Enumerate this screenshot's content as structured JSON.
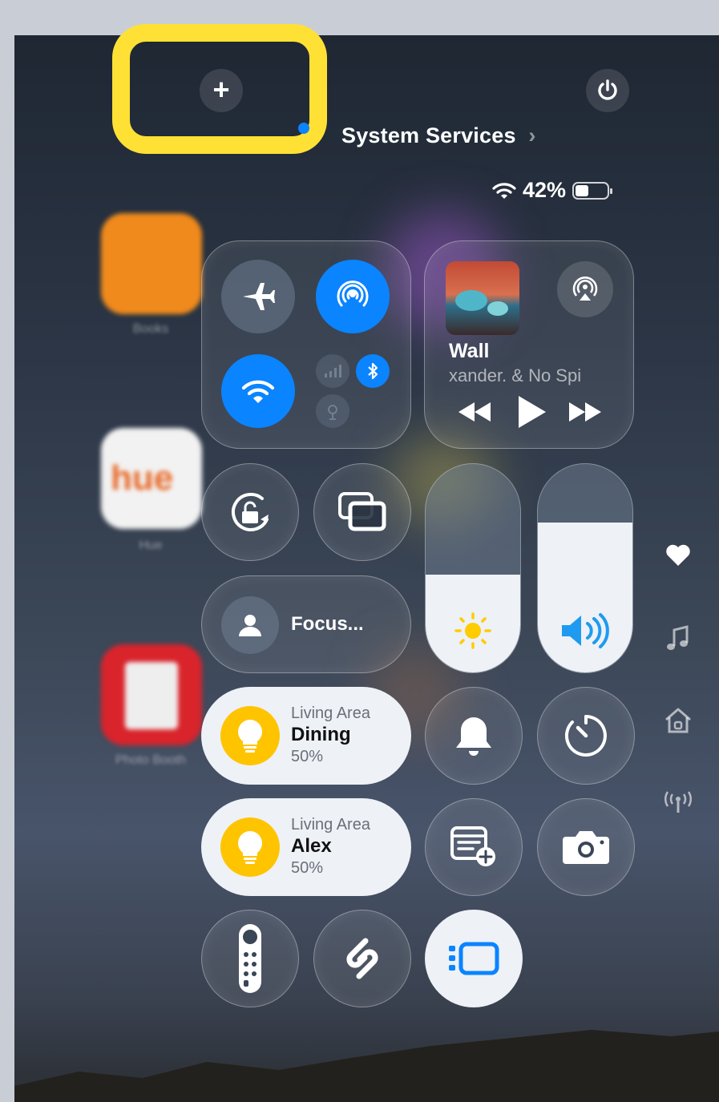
{
  "top_bar": {
    "add_symbol": "+",
    "section_link": "System Services",
    "chevron": "›"
  },
  "status_bar": {
    "battery_percent": "42%",
    "battery_level": 0.42,
    "icons": [
      "wifi-icon",
      "battery-icon"
    ]
  },
  "home_apps": [
    {
      "label": "Books",
      "icon": "books-icon",
      "color": "#f08a1c"
    },
    {
      "label": "Hue",
      "icon": "hue-icon",
      "color": "#f2f2f2"
    },
    {
      "label": "Photo Booth",
      "icon": "photo-booth-icon",
      "color": "#d9242c"
    }
  ],
  "connectivity": {
    "airplane": "airplane-icon",
    "airdrop": "airdrop-icon",
    "wifi": "wifi-icon",
    "cellular": "cellular-icon",
    "bluetooth": "bluetooth-icon",
    "satellite": "satellite-icon"
  },
  "now_playing": {
    "title": "Wall",
    "artist": "xander. & No Spi",
    "airplay_icon": "airplay-icon",
    "controls": [
      "rewind-icon",
      "play-icon",
      "forward-icon"
    ]
  },
  "toggles": {
    "rotation_lock": "rotation-lock-icon",
    "screen_mirroring": "screen-mirroring-icon",
    "focus_label": "Focus..."
  },
  "sliders": {
    "brightness_level": 0.47,
    "volume_level": 0.72
  },
  "home_controls": [
    {
      "room": "Living Area",
      "name": "Dining",
      "level": "50%"
    },
    {
      "room": "Living Area",
      "name": "Alex",
      "level": "50%"
    }
  ],
  "buttons": {
    "silent": "bell-icon",
    "timer": "timer-icon",
    "quick_note": "quick-note-icon",
    "camera": "camera-icon",
    "remote": "remote-icon",
    "shazam": "shazam-icon",
    "stage_manager": "stage-manager-icon"
  },
  "side_rail": [
    "heart-icon",
    "music-icon",
    "home-icon",
    "antenna-icon"
  ],
  "colors": {
    "accent_blue": "#0a84ff",
    "highlight_yellow": "#ffe135",
    "bulb_yellow": "#ffc400",
    "sun_yellow": "#ffcc00"
  }
}
